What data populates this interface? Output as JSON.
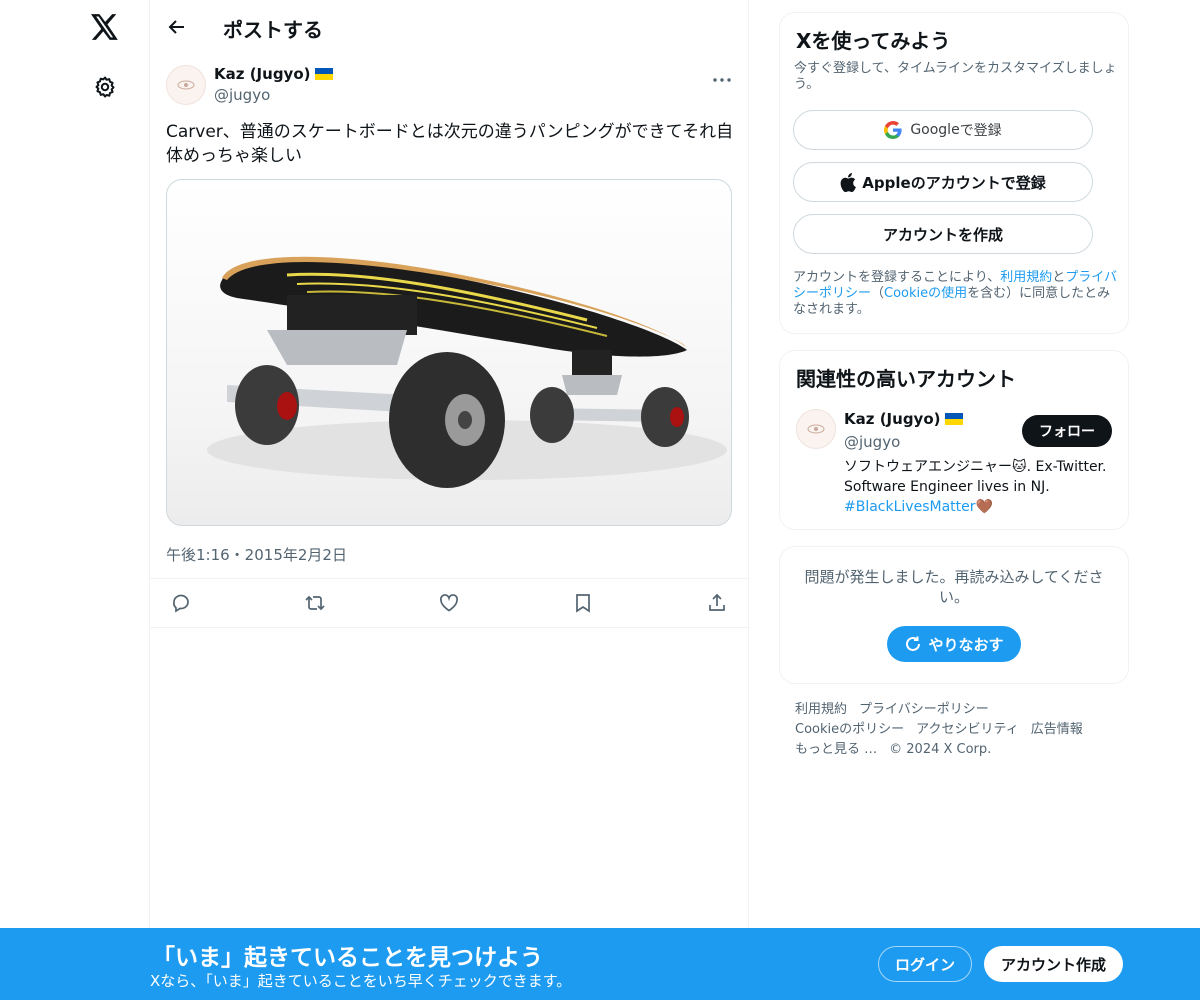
{
  "nav": {
    "logo_icon": "x-logo-icon",
    "settings_icon": "gear-icon"
  },
  "header": {
    "title": "ポストする",
    "back_icon": "arrow-left-icon"
  },
  "post": {
    "author_name": "Kaz (Jugyo)",
    "author_handle": "@jugyo",
    "flag": "ukraine-flag",
    "text": "Carver、普通のスケートボードとは次元の違うパンピングができてそれ自体めっちゃ楽しい",
    "timestamp": "午後1:16・2015年2月2日",
    "media_description": "",
    "actions": [
      "reply-icon",
      "repost-icon",
      "like-icon",
      "bookmark-icon",
      "share-icon"
    ]
  },
  "signup": {
    "title": "Xを使ってみよう",
    "subtitle": "今すぐ登録して、タイムラインをカスタマイズしましょう。",
    "google_label_brand": "Google",
    "google_label_suffix": " で登録",
    "apple_label": "Appleのアカウントで登録",
    "create_label": "アカウントを作成",
    "legal_prefix": "アカウントを登録することにより、",
    "legal_terms": "利用規約",
    "legal_and": "と",
    "legal_privacy": "プライバシーポリシー",
    "legal_open": "（",
    "legal_cookie": "Cookieの使用",
    "legal_suffix": "を含む）に同意したとみなされます。"
  },
  "relevant": {
    "title": "関連性の高いアカウント",
    "name": "Kaz (Jugyo)",
    "handle": "@jugyo",
    "follow_label": "フォロー",
    "bio_text": "ソフトウェアエンジニャー🐱. Ex-Twitter. Software Engineer lives in NJ. ",
    "bio_hashtag": "#BlackLivesMatter",
    "bio_emoji": "🤎"
  },
  "error": {
    "message": "問題が発生しました。再読み込みしてください。",
    "retry_label": "やりなおす"
  },
  "footer": {
    "links": [
      "利用規約",
      "プライバシーポリシー",
      "Cookieのポリシー",
      "アクセシビリティ",
      "広告情報",
      "もっと見る …",
      "© 2024 X Corp."
    ]
  },
  "banner": {
    "title": "「いま」起きていることを見つけよう",
    "subtitle": "Xなら、「いま」起きていることをいち早くチェックできます。",
    "login_label": "ログイン",
    "signup_label": "アカウント作成"
  },
  "colors": {
    "accent": "#1d9bf0",
    "text": "#0f1419",
    "muted": "#536471",
    "border": "#eff3f4"
  }
}
